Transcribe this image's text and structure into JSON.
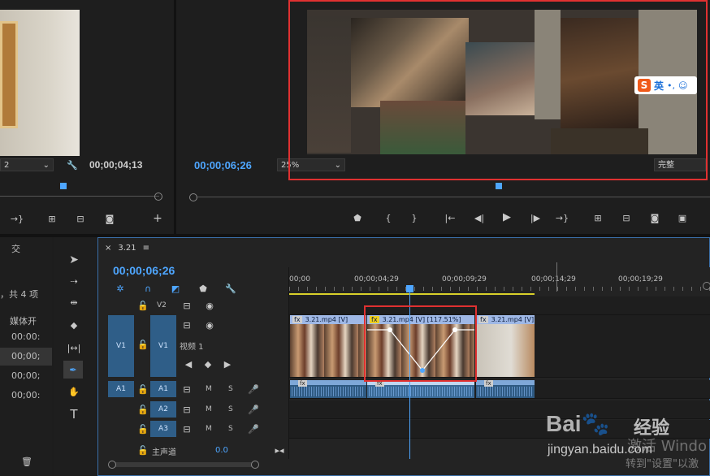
{
  "source_monitor": {
    "zoom_fragment": "2",
    "timecode": "00;00;04;13"
  },
  "program_monitor": {
    "timecode": "00;00;06;26",
    "zoom": "25%",
    "resolution": "完整",
    "ime_badge": {
      "letter": "S",
      "text": "英"
    }
  },
  "project_panel": {
    "header_fragment": "交",
    "items_fragment": "，共 4 项",
    "column_header": "媒体开",
    "rows": [
      "00:00:",
      "00;00;",
      "00;00;",
      "00;00:"
    ]
  },
  "timeline": {
    "tab_label": "3.21",
    "timecode": "00;00;06;26",
    "ruler": [
      "00;00",
      "00;00;04;29",
      "00;00;09;29",
      "00;00;14;29",
      "00;00;19;29"
    ],
    "tracks": {
      "v2": {
        "label": "V2"
      },
      "v1": {
        "source": "V1",
        "label": "V1",
        "name": "视频 1"
      },
      "a1": {
        "source": "A1",
        "label": "A1",
        "m": "M",
        "s": "S"
      },
      "a2": {
        "label": "A2",
        "m": "M",
        "s": "S"
      },
      "a3": {
        "label": "A3",
        "m": "M",
        "s": "S"
      },
      "master": {
        "label": "主声道",
        "value": "0.0"
      }
    },
    "clips": [
      {
        "fx": "fx",
        "label": "3.21.mp4 [V]"
      },
      {
        "fx": "fx",
        "label": "3.21.mp4 [V] [117.51%]"
      },
      {
        "fx": "fx",
        "label": "3.21.mp4 [V]"
      }
    ],
    "audio_clips": [
      {
        "fx": "fx"
      },
      {
        "fx": "fx"
      },
      {
        "fx": "fx"
      }
    ]
  },
  "watermark": {
    "brand_text": "经验",
    "url": "jingyan.baidu.com",
    "activate_line1": "激活 Windo",
    "activate_line2": "转到\"设置\"以激"
  },
  "colors": {
    "accent": "#4ea6ff",
    "highlight": "#e03131",
    "track_blue": "#2f5e88"
  }
}
